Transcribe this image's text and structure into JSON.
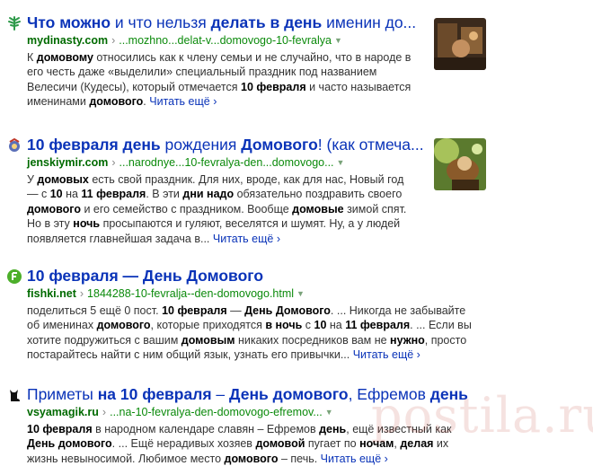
{
  "results": [
    {
      "title": [
        "Что можно",
        " и что нельзя ",
        "делать в день",
        " именин до..."
      ],
      "host": "mydinasty.com",
      "path": "...mozhno...delat-v...domovogo-10-fevralya",
      "favicon": "tree-icon",
      "snippet": [
        "К ",
        "домовому",
        " относились как к члену семьи и не случайно, что в народе в его честь даже «выделили» специальный праздник под названием Велесичи (Кудесы), который отмечается ",
        "10 февраля",
        " и часто называется именинами ",
        "домового",
        ". "
      ],
      "more": "Читать ещё"
    },
    {
      "title": [
        "10 февраля день",
        " рождения ",
        "Домового",
        "! (как отмеча..."
      ],
      "host": "jenskiymir.com",
      "path": "...narodnye...10-fevralya-den...domovogo...",
      "favicon": "ring-icon",
      "snippet": [
        "У ",
        "домовых",
        " есть свой праздник. Для них, вроде, как для нас, Новый год — с ",
        "10",
        " на ",
        "11 февраля",
        ". В эти ",
        "дни надо",
        " обязательно поздравить своего ",
        "домового",
        " и его семейство с праздником. Вообще ",
        "домовые",
        " зимой спят. Но в эту ",
        "ночь",
        " просыпаются и гуляют, веселятся и шумят. Ну, а у людей появляется главнейшая задача в... "
      ],
      "more": "Читать ещё"
    },
    {
      "title": [
        "10 февраля",
        " — ",
        "День Домового",
        ""
      ],
      "host": "fishki.net",
      "path": "1844288-10-fevralja--den-domovogo.html",
      "favicon": "f-icon",
      "snippet": [
        "поделиться 5 ещё 0 пост. ",
        "10 февраля",
        " — ",
        "День Домового",
        ". ... Никогда не забывайте об именинах ",
        "домового",
        ", которые приходятся ",
        "в ночь",
        " с ",
        "10",
        " на ",
        "11 февраля",
        ". ... Если вы хотите подружиться с вашим ",
        "домовым",
        " никаких посредников вам не ",
        "нужно",
        ", просто постарайтесь найти с ним общий язык, узнать его привычки... "
      ],
      "more": "Читать ещё"
    },
    {
      "title": [
        "Приметы",
        " на ",
        "10 февраля",
        " – ",
        "День домового",
        ", Ефремов ",
        "день"
      ],
      "host": "vsyamagik.ru",
      "path": "...na-10-fevralya-den-domovogo-efremov...",
      "favicon": "cat-icon",
      "snippet": [
        "10 февраля",
        " в народном календаре славян – Ефремов ",
        "день",
        ", ещё известный как ",
        "День домового",
        ". ... Ещё нерадивых хозяев ",
        "домовой",
        " пугает по ",
        "ночам",
        ", ",
        "делая",
        " их жизнь невыносимой. Любимое место ",
        "домового",
        " – печь. "
      ],
      "more": "Читать ещё"
    }
  ],
  "watermark": "postila.ru",
  "colors": {
    "link": "#0a33b8",
    "url": "#006a00",
    "text": "#333333"
  }
}
